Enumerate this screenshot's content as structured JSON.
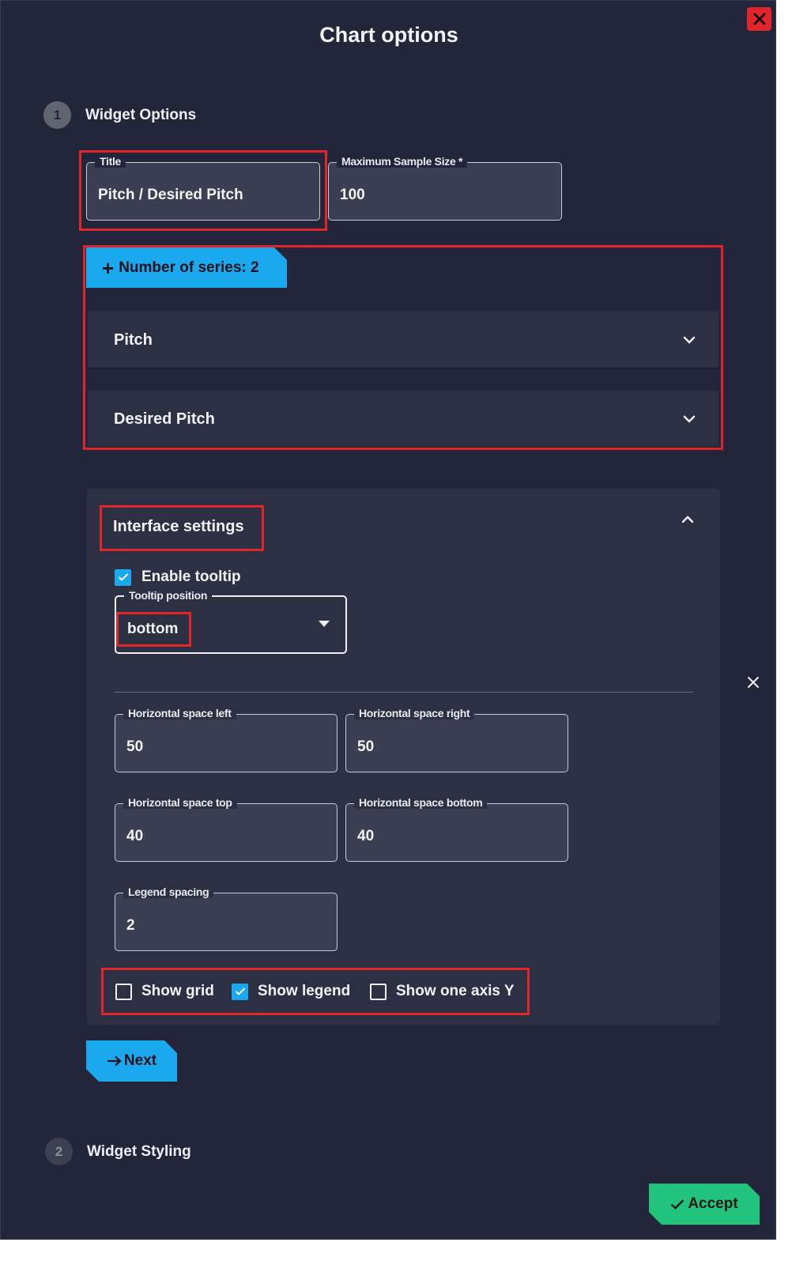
{
  "dialog": {
    "title": "Chart options",
    "close_icon": "close-icon"
  },
  "steps": [
    {
      "number": "1",
      "label": "Widget Options"
    },
    {
      "number": "2",
      "label": "Widget Styling"
    }
  ],
  "fields": {
    "title": {
      "label": "Title",
      "value": "Pitch / Desired Pitch"
    },
    "max_sample": {
      "label": "Maximum Sample Size *",
      "value": "100"
    }
  },
  "series": {
    "add_label": "Number of series: 2",
    "items": [
      {
        "label": "Pitch"
      },
      {
        "label": "Desired Pitch"
      }
    ]
  },
  "interface": {
    "heading": "Interface settings",
    "enable_tooltip": {
      "label": "Enable tooltip",
      "checked": true
    },
    "tooltip_position": {
      "label": "Tooltip position",
      "value": "bottom"
    },
    "spacing": {
      "left": {
        "label": "Horizontal space left",
        "value": "50"
      },
      "right": {
        "label": "Horizontal space right",
        "value": "50"
      },
      "top": {
        "label": "Horizontal space top",
        "value": "40"
      },
      "bottom": {
        "label": "Horizontal space bottom",
        "value": "40"
      },
      "legend": {
        "label": "Legend spacing",
        "value": "2"
      }
    },
    "checkboxes": {
      "show_grid": {
        "label": "Show grid",
        "checked": false
      },
      "show_legend": {
        "label": "Show legend",
        "checked": true
      },
      "show_one_axis": {
        "label": "Show one axis Y",
        "checked": false
      }
    }
  },
  "buttons": {
    "next": "Next",
    "accept": "Accept"
  },
  "colors": {
    "background": "#23263a",
    "panel": "#2d3043",
    "accent": "#1aa9ef",
    "accept": "#22c27f",
    "close": "#e1262b",
    "highlight": "#e1262b"
  }
}
